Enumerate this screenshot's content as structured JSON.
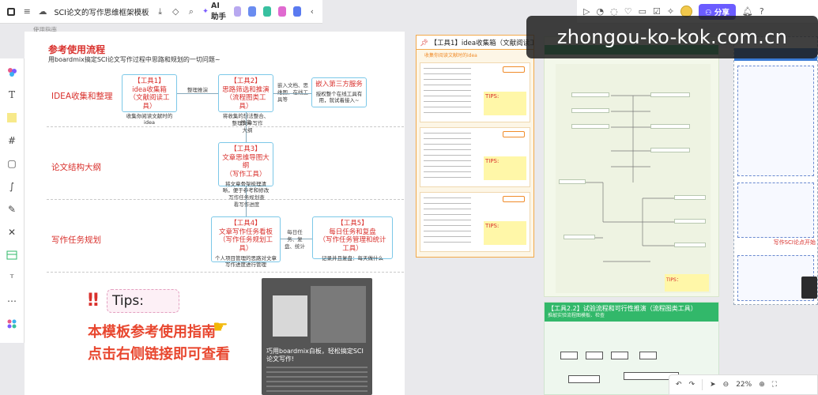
{
  "toolbar": {
    "doc_title": "SCI论文的写作思维框架模板",
    "ai_label": "AI助手",
    "share_label": "分享"
  },
  "frame_label": "使用指南",
  "board": {
    "title": "参考使用流程",
    "subtitle": "用boardmix搞定SCI论文写作过程中思路和规划的一切问题~",
    "rows": [
      "IDEA收集和整理",
      "论文结构大纲",
      "写作任务规划"
    ],
    "tool1": {
      "title": "【工具1】",
      "name": "idea收集箱",
      "type": "（文献阅读工具）",
      "desc": "收集你阅读文献时的idea"
    },
    "tool2": {
      "title": "【工具2】",
      "name": "思路筛选和推演",
      "type": "（流程图类工具）",
      "desc": "将收集的想法整合、推演"
    },
    "tool3": {
      "title": "【工具3】",
      "name": "文章思维导图大纲",
      "type": "（写作工具）",
      "desc": "将文章骨架梳理清晰，便于参考和修改"
    },
    "tool4": {
      "title": "【工具4】",
      "name": "文章写作任务看板",
      "type": "（写作任务规划工具）",
      "desc": "个人项目管理的思路对文章写作进度进行管理"
    },
    "tool5": {
      "title": "【工具5】",
      "name": "每日任务和复盘",
      "type": "（写作任务管理和统计工具）",
      "desc": "记录并且复盘：每天做什么"
    },
    "embed": {
      "name": "嵌入第三方服务",
      "desc": "授权整个在线工具有用，就试着接入~"
    },
    "notes": {
      "n1": "整理推演",
      "n2": "嵌入文档、思维图、在线工具等",
      "n3": "整理文章写作大纲",
      "n4": "写作任务规划查看写作进度",
      "n5": "每日任务、复盘、统计"
    },
    "tips_label": "Tips:",
    "guide_line1": "本模板参考使用指南",
    "guide_line2": "点击右侧链接即可查看",
    "preview_title": "巧用boardmix白板，轻松搞定SCI论文写作!"
  },
  "frames": {
    "frame1_title": "【工具1】idea收集箱（文献阅读工具）",
    "frame1_sub": "收集你阅读文献时的idea",
    "frame1_tips": [
      "TIPS:",
      "TIPS:",
      "TIPS:"
    ],
    "frame2_tip": "TIPS：",
    "frame3_title": "【工具2.2】试验流程和可行性推演（流程图类工具）",
    "frame3_sub": "推敲实验流程图模板、检查",
    "frame4_side": "写作SCI论点开始"
  },
  "watermark": "zhongou-ko-kok.com.cn",
  "zoom": {
    "value": "22%"
  }
}
